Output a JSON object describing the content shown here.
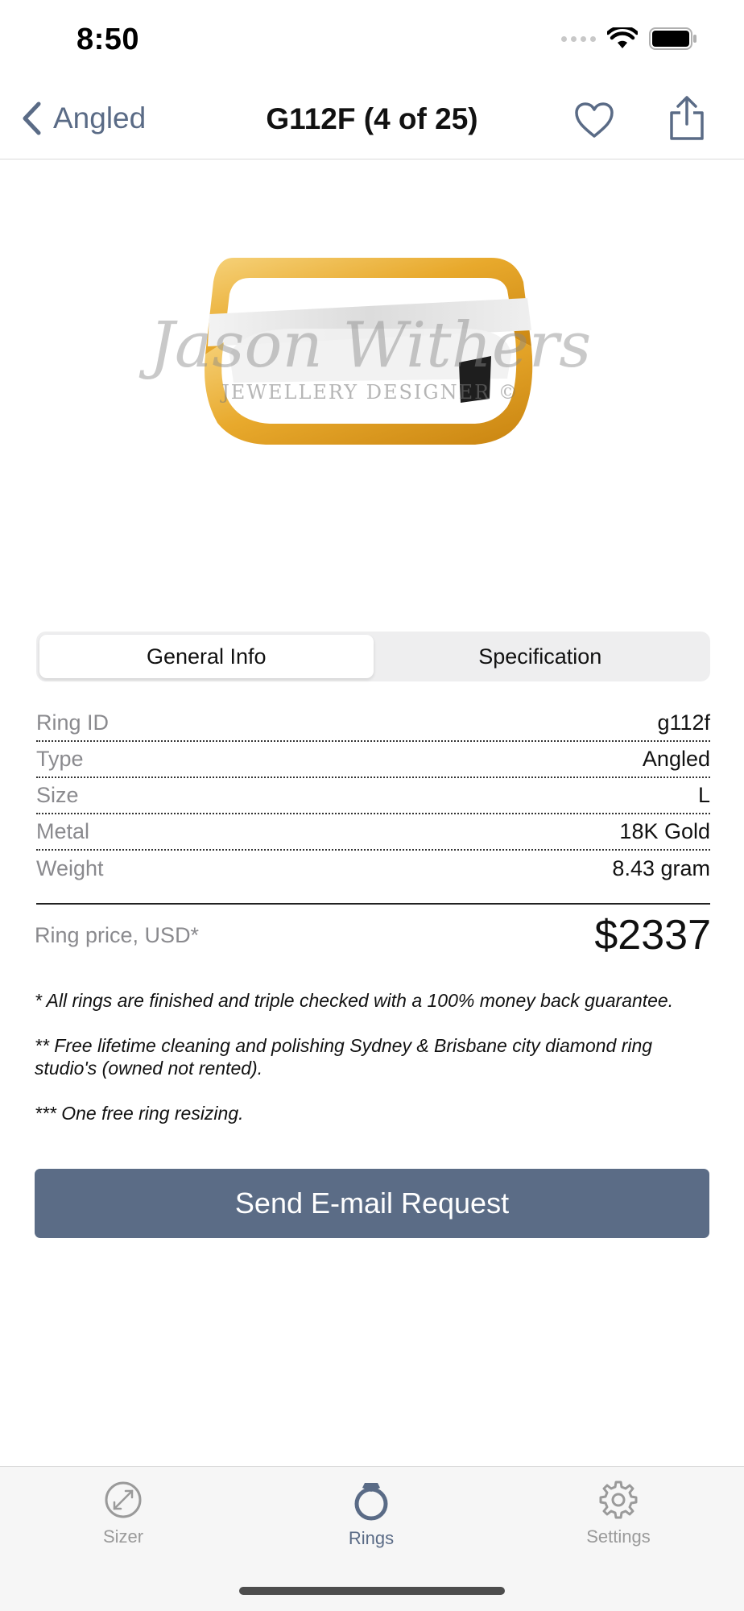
{
  "status_bar": {
    "time": "8:50"
  },
  "nav": {
    "back_label": "Angled",
    "title": "G112F (4 of 25)"
  },
  "product_image": {
    "watermark_name": "Jason Withers",
    "watermark_sub": "JEWELLERY DESIGNER ©"
  },
  "segments": [
    "General Info",
    "Specification"
  ],
  "details": [
    {
      "label": "Ring ID",
      "value": "g112f"
    },
    {
      "label": "Type",
      "value": "Angled"
    },
    {
      "label": "Size",
      "value": "L"
    },
    {
      "label": "Metal",
      "value": "18K Gold"
    },
    {
      "label": "Weight",
      "value": "8.43 gram"
    }
  ],
  "price": {
    "label": "Ring price, USD*",
    "value": "$2337"
  },
  "notes": [
    "* All rings are finished and triple checked with a 100% money back guarantee.",
    "** Free lifetime cleaning and polishing Sydney & Brisbane city diamond ring studio's (owned not rented).",
    "*** One free ring resizing."
  ],
  "email_button": "Send E-mail Request",
  "tabs": [
    {
      "label": "Sizer",
      "icon": "sizer-icon"
    },
    {
      "label": "Rings",
      "icon": "ring-icon"
    },
    {
      "label": "Settings",
      "icon": "gear-icon"
    }
  ],
  "colors": {
    "accent": "#5b6c86",
    "gold": "#e8a92c",
    "white_gold": "#e6e6e6"
  }
}
